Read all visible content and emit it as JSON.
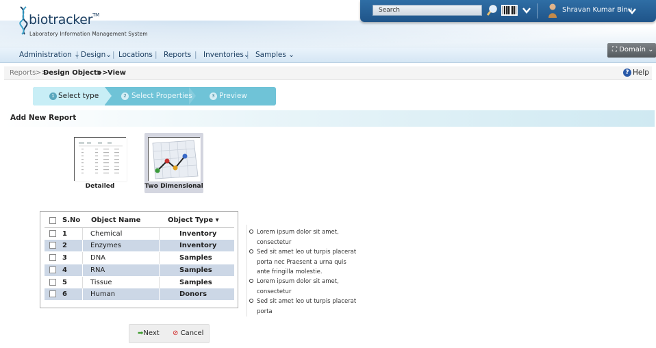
{
  "app": {
    "logo_text": "biotracker",
    "logo_tm": "TM",
    "subtitle": "Laboratory Information Management System"
  },
  "topbar": {
    "search_placeholder": "Search",
    "user_name": "Shravan Kumar Binu"
  },
  "nav": {
    "items": [
      "Administration",
      "Design",
      "Locations",
      "Reports",
      "Inventories",
      "Samples"
    ],
    "domain_label": "Domain"
  },
  "breadcrumb": {
    "root": "Reports",
    "sep1": ">>",
    "middle": "Design Objects",
    "sep2": ">>",
    "current": "View",
    "help_label": "Help"
  },
  "wizard": {
    "steps": [
      {
        "num": "1",
        "label": "Select type"
      },
      {
        "num": "2",
        "label": "Select Properties"
      },
      {
        "num": "3",
        "label": "Preview"
      }
    ]
  },
  "section": {
    "title": "Add New Report"
  },
  "report_types": [
    {
      "label": "Detailed"
    },
    {
      "label": "Two Dimensional"
    }
  ],
  "table": {
    "headers": {
      "sno": "S.No",
      "name": "Object Name",
      "type": "Object Type"
    },
    "rows": [
      {
        "sno": "1",
        "name": "Chemical",
        "type": "Inventory"
      },
      {
        "sno": "2",
        "name": "Enzymes",
        "type": "Inventory"
      },
      {
        "sno": "3",
        "name": "DNA",
        "type": "Samples"
      },
      {
        "sno": "4",
        "name": "RNA",
        "type": "Samples"
      },
      {
        "sno": "5",
        "name": "Tissue",
        "type": "Samples"
      },
      {
        "sno": "6",
        "name": "Human",
        "type": "Donors"
      }
    ]
  },
  "notes": [
    "Lorem ipsum dolor sit amet, consectetur",
    "Sed sit amet leo ut turpis placerat porta nec Praesent a urna quis ante fringilla molestie.",
    "Lorem ipsum dolor sit amet, consectetur",
    "Sed sit amet leo ut turpis placerat porta"
  ],
  "buttons": {
    "next": "Next",
    "cancel": "Cancel"
  },
  "colors": {
    "accent": "#1f5489",
    "wizard": "#6fc3d7",
    "row_alt": "#ccd7e6"
  }
}
